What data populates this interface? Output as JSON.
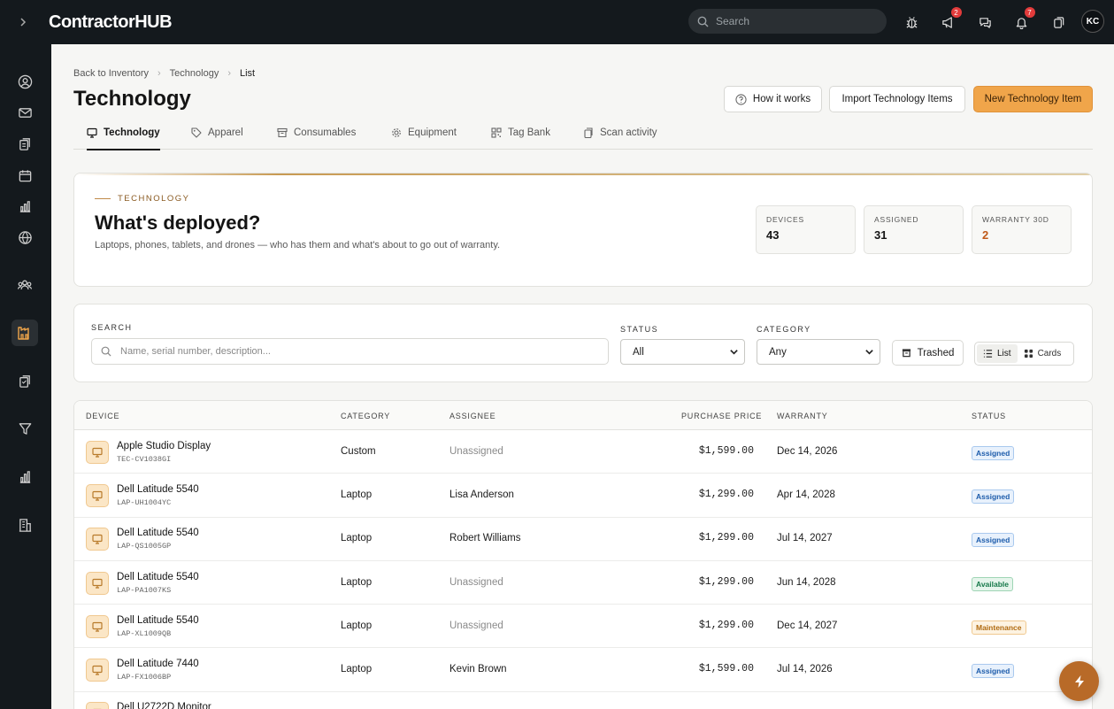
{
  "app": {
    "logo": "ContractorHUB"
  },
  "topbar": {
    "search_placeholder": "Search",
    "announcements_badge": "2",
    "notifications_badge": "7",
    "avatar_initials": "KC"
  },
  "breadcrumb": [
    "Back to Inventory",
    "Technology",
    "List"
  ],
  "page": {
    "title": "Technology"
  },
  "actions": {
    "how_it_works": "How it works",
    "import": "Import Technology Items",
    "new_item": "New Technology Item"
  },
  "tabs": [
    {
      "label": "Technology",
      "icon": "monitor-icon",
      "active": true
    },
    {
      "label": "Apparel",
      "icon": "tag-icon"
    },
    {
      "label": "Consumables",
      "icon": "archive-icon"
    },
    {
      "label": "Equipment",
      "icon": "cog-icon"
    },
    {
      "label": "Tag Bank",
      "icon": "qr-icon"
    },
    {
      "label": "Scan activity",
      "icon": "clipboard-icon"
    }
  ],
  "hero": {
    "eyebrow": "TECHNOLOGY",
    "title": "What's deployed?",
    "description": "Laptops, phones, tablets, and drones — who has them and what's about to go out of warranty.",
    "stats": [
      {
        "label": "DEVICES",
        "value": "43"
      },
      {
        "label": "ASSIGNED",
        "value": "31"
      },
      {
        "label": "WARRANTY 30D",
        "value": "2"
      }
    ]
  },
  "filters": {
    "search_label": "SEARCH",
    "search_placeholder": "Name, serial number, description...",
    "status_label": "STATUS",
    "status_value": "All",
    "category_label": "CATEGORY",
    "category_value": "Any",
    "trashed": "Trashed",
    "view_list": "List",
    "view_cards": "Cards"
  },
  "table": {
    "columns": [
      "DEVICE",
      "CATEGORY",
      "ASSIGNEE",
      "PURCHASE PRICE",
      "WARRANTY",
      "STATUS"
    ],
    "rows": [
      {
        "name": "Apple Studio Display",
        "serial": "TEC-CV1038GI",
        "category": "Custom",
        "assignee": "Unassigned",
        "price": "$1,599.00",
        "warranty": "Dec 14, 2026",
        "status": "Assigned"
      },
      {
        "name": "Dell Latitude 5540",
        "serial": "LAP-UH1004YC",
        "category": "Laptop",
        "assignee": "Lisa Anderson",
        "price": "$1,299.00",
        "warranty": "Apr 14, 2028",
        "status": "Assigned"
      },
      {
        "name": "Dell Latitude 5540",
        "serial": "LAP-QS1005GP",
        "category": "Laptop",
        "assignee": "Robert Williams",
        "price": "$1,299.00",
        "warranty": "Jul 14, 2027",
        "status": "Assigned"
      },
      {
        "name": "Dell Latitude 5540",
        "serial": "LAP-PA1007KS",
        "category": "Laptop",
        "assignee": "Unassigned",
        "price": "$1,299.00",
        "warranty": "Jun 14, 2028",
        "status": "Available"
      },
      {
        "name": "Dell Latitude 5540",
        "serial": "LAP-XL1009QB",
        "category": "Laptop",
        "assignee": "Unassigned",
        "price": "$1,299.00",
        "warranty": "Dec 14, 2027",
        "status": "Maintenance"
      },
      {
        "name": "Dell Latitude 7440",
        "serial": "LAP-FX1006BP",
        "category": "Laptop",
        "assignee": "Kevin Brown",
        "price": "$1,599.00",
        "warranty": "Jul 14, 2026",
        "status": "Assigned"
      },
      {
        "name": "Dell U2722D Monitor",
        "serial": "",
        "category": "",
        "assignee": "",
        "price": "",
        "warranty": "",
        "status": ""
      }
    ]
  }
}
